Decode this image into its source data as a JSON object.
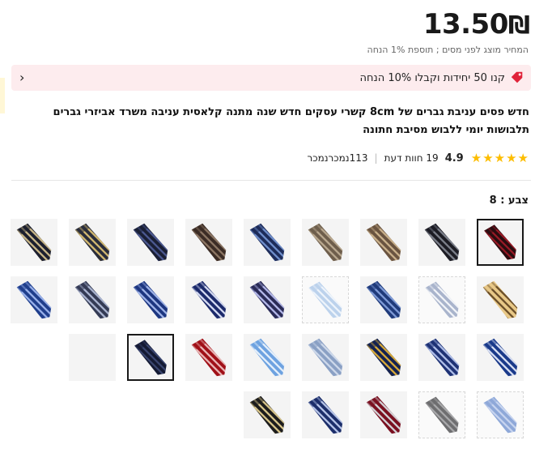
{
  "price": {
    "amount": "13.50",
    "currency": "₪"
  },
  "tax_note": "המחיר מוצג לפני מסים ; תוספת 1% הנחה",
  "promo": {
    "text": "קנו 50 יחידות וקבלו 10% הנחה",
    "tag_icon": "tag-icon",
    "chevron_icon": "chevron-left-icon",
    "accent": "#e0233a"
  },
  "product": {
    "title_line1": "חדש פסים עניבת גברים של 8cm קשרי עסקים חדש שנה מתנה קלאסית עניבה משרד אביזרי גברים",
    "title_line2": "תלבושות יומי ללבוש מסיבת חתונה"
  },
  "rating": {
    "value": "4.9",
    "stars": 5,
    "reviews_count": "19",
    "reviews_label": "חוות דעת",
    "sold_count": "113",
    "sold_label": "נמכרנמכר",
    "separator": "|"
  },
  "color": {
    "label": "צבע : 8"
  },
  "swatches": [
    {
      "base": "#2a0d10",
      "stripe": "#9a1a26"
    },
    {
      "base": "#1c1c24",
      "stripe": "#7b7f8a"
    },
    {
      "base": "#6a5440",
      "stripe": "#c9b08a"
    },
    {
      "base": "#6e5e4c",
      "stripe": "#b8a78e"
    },
    {
      "base": "#1d2c5a",
      "stripe": "#6f8ecb"
    },
    {
      "base": "#3b2c25",
      "stripe": "#8c7664"
    },
    {
      "base": "#1a1f35",
      "stripe": "#4b5890"
    },
    {
      "base": "#2a2d3a",
      "stripe": "#d2b870"
    },
    {
      "base": "#1c1f2e",
      "stripe": "#c8b687"
    },
    {
      "base": "#e8c887",
      "stripe": "#6b4f2a"
    },
    {
      "base": "#a9b4cc",
      "stripe": "#f2f4f8",
      "light": true
    },
    {
      "base": "#1f3a7a",
      "stripe": "#7e9ad6"
    },
    {
      "base": "#bcd2ec",
      "stripe": "#eef4fb",
      "light": true
    },
    {
      "base": "#2a2b57",
      "stripe": "#b3b7e8"
    },
    {
      "base": "#1c2a6b",
      "stripe": "#d4daf2"
    },
    {
      "base": "#1d3680",
      "stripe": "#9fb3e8"
    },
    {
      "base": "#343b55",
      "stripe": "#a9b3cf"
    },
    {
      "base": "#1f3e8c",
      "stripe": "#98b0ea"
    },
    {
      "base": "#1a3a8a",
      "stripe": "#d7def2"
    },
    {
      "base": "#1e3275",
      "stripe": "#aebde8"
    },
    {
      "base": "#142250",
      "stripe": "#d7a93a"
    },
    {
      "base": "#8aa0c4",
      "stripe": "#cdd8ea"
    },
    {
      "base": "#6ea2e0",
      "stripe": "#e4effb"
    },
    {
      "base": "#a01018",
      "stripe": "#e8b4b4"
    },
    {
      "base": "#141a33",
      "stripe": "#3a4670"
    },
    {
      "base": "#ffffff",
      "stripe": "#ffffff",
      "empty": true
    },
    {
      "base": "#8ea8d8",
      "stripe": "#c7d4ef",
      "light": true
    },
    {
      "base": "#6e6e70",
      "stripe": "#a9a9ab",
      "light": true
    },
    {
      "base": "#7a1020",
      "stripe": "#d2d2d6"
    },
    {
      "base": "#1c2e6a",
      "stripe": "#b6c4e8"
    },
    {
      "base": "#1d1d1d",
      "stripe": "#d8c58a"
    }
  ],
  "selected_index": 0,
  "hovered_index": 24
}
